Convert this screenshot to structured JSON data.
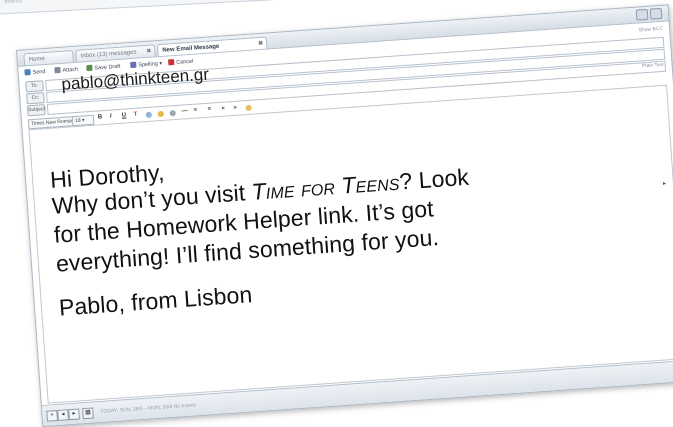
{
  "background": {
    "strip_text": "events"
  },
  "tabs": [
    {
      "label": "Home"
    },
    {
      "label": "Inbox (13) messages"
    },
    {
      "label": "New Email Message"
    }
  ],
  "toolbar": {
    "send": "Send",
    "attach": "Attach",
    "save_draft": "Save Draft",
    "spelling": "Spelling",
    "cancel": "Cancel",
    "show_bcc": "Show BCC"
  },
  "fields": {
    "to_label": "To:",
    "to_value": "pablo@thinkteen.gr",
    "cc_label": "Cc:",
    "subject_label": "Subject:",
    "plain_text": "Plain Text"
  },
  "format": {
    "font": "Times New Roman",
    "size": "18"
  },
  "message": {
    "greeting": "Hi Dorothy,",
    "line1_pre": "Why don’t you visit ",
    "site_name": "Time for Teens",
    "line1_post": "? Look",
    "line2": "for the Homework Helper link. It’s got",
    "line3": "everything! I’ll find something for you.",
    "signature": "Pablo, from Lisbon"
  },
  "statusbar": {
    "text": "TODAY: SUN, 29/5 – MON, 30/6  No events"
  },
  "colors": {
    "accent": "#2f5f9a",
    "cancel": "#cc3333"
  }
}
